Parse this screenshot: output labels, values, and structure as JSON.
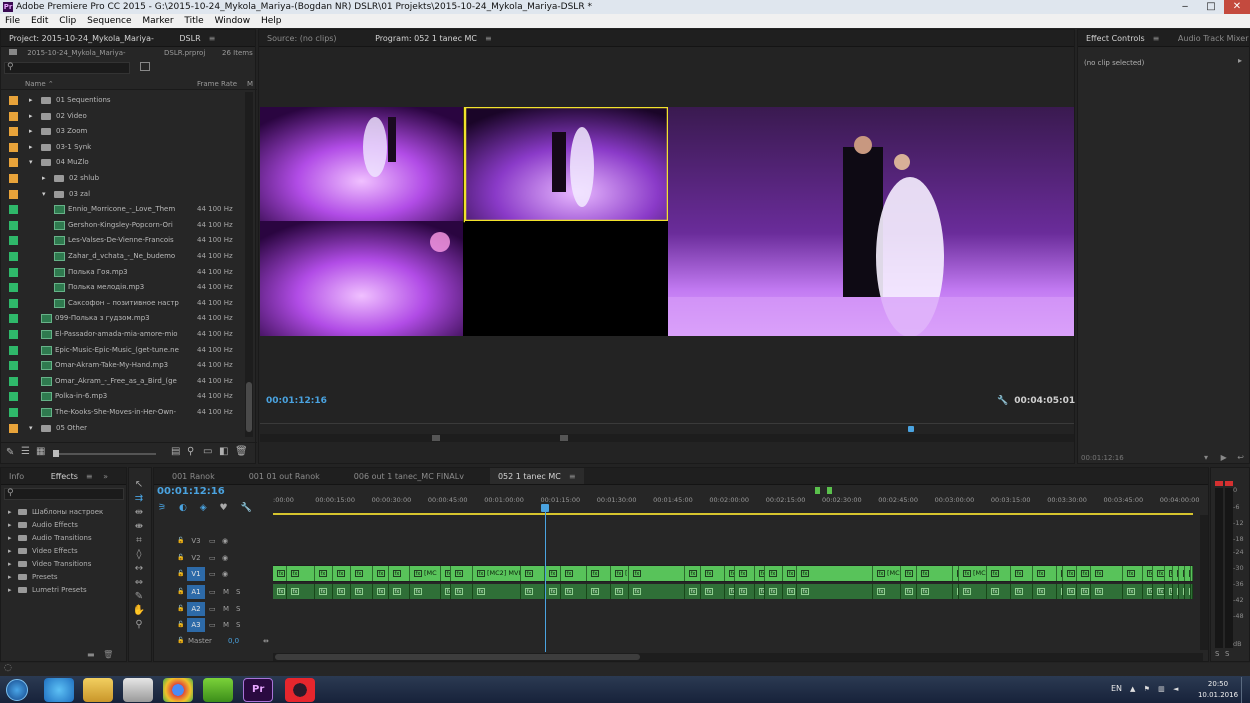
{
  "window": {
    "title": "Adobe Premiere Pro CC 2015 - G:\\2015-10-24_Mykola_Mariya-(Bogdan NR) DSLR\\01 Projekts\\2015-10-24_Mykola_Mariya-DSLR *",
    "minimize": "‒",
    "maximize": "□",
    "close": "✕"
  },
  "menu": [
    "File",
    "Edit",
    "Clip",
    "Sequence",
    "Marker",
    "Title",
    "Window",
    "Help"
  ],
  "project": {
    "tab_label": "Project: 2015-10-24_Mykola_Mariya-",
    "tab_label2": "DSLR",
    "file_name": "2015-10-24_Mykola_Mariya-",
    "file_ext": "DSLR.prproj",
    "item_count": "26 Items",
    "col_name": "Name",
    "col_rate": "Frame Rate",
    "rows": [
      {
        "label": "01 Sequentions",
        "type": "folder",
        "level": 0,
        "open": false,
        "color": "#e8a33a"
      },
      {
        "label": "02 Video",
        "type": "folder",
        "level": 0,
        "open": false,
        "color": "#e8a33a"
      },
      {
        "label": "03 Zoom",
        "type": "folder",
        "level": 0,
        "open": false,
        "color": "#e8a33a"
      },
      {
        "label": "03-1 Synk",
        "type": "folder",
        "level": 0,
        "open": false,
        "color": "#e8a33a"
      },
      {
        "label": "04 MuZlo",
        "type": "folder",
        "level": 0,
        "open": true,
        "color": "#e8a33a"
      },
      {
        "label": "02 shlub",
        "type": "folder",
        "level": 1,
        "open": false,
        "color": "#e8a33a"
      },
      {
        "label": "03 zal",
        "type": "folder",
        "level": 1,
        "open": true,
        "color": "#e8a33a"
      },
      {
        "label": "Ennio_Morricone_-_Love_Them",
        "type": "audio",
        "level": 3,
        "rate": "44 100 Hz",
        "color": "#2fb86a"
      },
      {
        "label": "Gershon-Kingsley-Popcorn-Ori",
        "type": "audio",
        "level": 3,
        "rate": "44 100 Hz",
        "color": "#2fb86a"
      },
      {
        "label": "Les-Valses-De-Vienne-Francois",
        "type": "audio",
        "level": 3,
        "rate": "44 100 Hz",
        "color": "#2fb86a"
      },
      {
        "label": "Zahar_d_vchata_-_Ne_budemo",
        "type": "audio",
        "level": 3,
        "rate": "44 100 Hz",
        "color": "#2fb86a"
      },
      {
        "label": "Полька Гоя.mp3",
        "type": "audio",
        "level": 3,
        "rate": "44 100 Hz",
        "color": "#2fb86a"
      },
      {
        "label": "Полька мелодія.mp3",
        "type": "audio",
        "level": 3,
        "rate": "44 100 Hz",
        "color": "#2fb86a"
      },
      {
        "label": "Саксофон – позитивное настр",
        "type": "audio",
        "level": 3,
        "rate": "44 100 Hz",
        "color": "#2fb86a"
      },
      {
        "label": "099-Полька з гудзом.mp3",
        "type": "audio",
        "level": 2,
        "rate": "44 100 Hz",
        "color": "#2fb86a"
      },
      {
        "label": "El-Passador-amada-mia-amore-mio",
        "type": "audio",
        "level": 2,
        "rate": "44 100 Hz",
        "color": "#2fb86a"
      },
      {
        "label": "Epic-Music-Epic-Music_(get-tune.ne",
        "type": "audio",
        "level": 2,
        "rate": "44 100 Hz",
        "color": "#2fb86a"
      },
      {
        "label": "Omar-Akram-Take-My-Hand.mp3",
        "type": "audio",
        "level": 2,
        "rate": "44 100 Hz",
        "color": "#2fb86a"
      },
      {
        "label": "Omar_Akram_-_Free_as_a_Bird_(ge",
        "type": "audio",
        "level": 2,
        "rate": "44 100 Hz",
        "color": "#2fb86a"
      },
      {
        "label": "Polka-in-6.mp3",
        "type": "audio",
        "level": 2,
        "rate": "44 100 Hz",
        "color": "#2fb86a"
      },
      {
        "label": "The-Kooks-She-Moves-in-Her-Own-",
        "type": "audio",
        "level": 2,
        "rate": "44 100 Hz",
        "color": "#2fb86a"
      },
      {
        "label": "05 Other",
        "type": "folder",
        "level": 0,
        "open": true,
        "color": "#e8a33a"
      }
    ]
  },
  "source": {
    "tab_label": "Source: (no clips)"
  },
  "program": {
    "tab_label": "Program: 052 1 tanec MC",
    "timecode_current": "00:01:12:16",
    "timecode_duration": "00:04:05:01"
  },
  "effect_controls": {
    "tab_label": "Effect Controls",
    "tab_label2": "Audio Track Mixer",
    "no_clip": "(no clip selected)",
    "timecode": "00:01:12:16"
  },
  "effects_panel": {
    "tab_info": "Info",
    "tab_effects": "Effects",
    "items": [
      "Шаблоны настроек",
      "Audio Effects",
      "Audio Transitions",
      "Video Effects",
      "Video Transitions",
      "Presets",
      "Lumetri Presets"
    ]
  },
  "timeline": {
    "tabs": [
      {
        "label": "001 Ranok",
        "active": false
      },
      {
        "label": "001 01 out  Ranok",
        "active": false
      },
      {
        "label": "006 out 1 tanec_MC FINALv",
        "active": false
      },
      {
        "label": "052 1 tanec MC",
        "active": true
      }
    ],
    "timecode": "00:01:12:16",
    "ruler": [
      ":00:00",
      "00:00:15:00",
      "00:00:30:00",
      "00:00:45:00",
      "00:01:00:00",
      "00:01:15:00",
      "00:01:30:00",
      "00:01:45:00",
      "00:02:00:00",
      "00:02:15:00",
      "00:02:30:00",
      "00:02:45:00",
      "00:03:00:00",
      "00:03:15:00",
      "00:03:30:00",
      "00:03:45:00",
      "00:04:00:00"
    ],
    "tracks": [
      {
        "name": "V3",
        "kind": "video"
      },
      {
        "name": "V2",
        "kind": "video"
      },
      {
        "name": "V1",
        "kind": "video",
        "target": true
      },
      {
        "name": "A1",
        "kind": "audio",
        "target": true,
        "m": "M",
        "s": "S"
      },
      {
        "name": "A2",
        "kind": "audio",
        "target": true,
        "m": "M",
        "s": "S"
      },
      {
        "name": "A3",
        "kind": "audio",
        "target": true,
        "m": "M",
        "s": "S"
      }
    ],
    "master_label": "Master",
    "master_value": "0,0",
    "v1_clip_labels": [
      "[MC",
      "[MC2] MVI_(",
      "[MC2] MVI_406",
      "[MC3]",
      "[MC",
      "[MC2] MVI_4062.MOV",
      "[MC3] MVI_9988.",
      "[MC3",
      "[MC2]"
    ]
  },
  "meter": {
    "labels": [
      "0",
      "-6",
      "-12",
      "-18",
      "-24",
      "-30",
      "-36",
      "-42",
      "-48",
      "dB"
    ],
    "solo": "S"
  },
  "taskbar": {
    "lang": "EN",
    "time": "20:50",
    "date": "10.01.2016",
    "pr_label": "Pr"
  }
}
